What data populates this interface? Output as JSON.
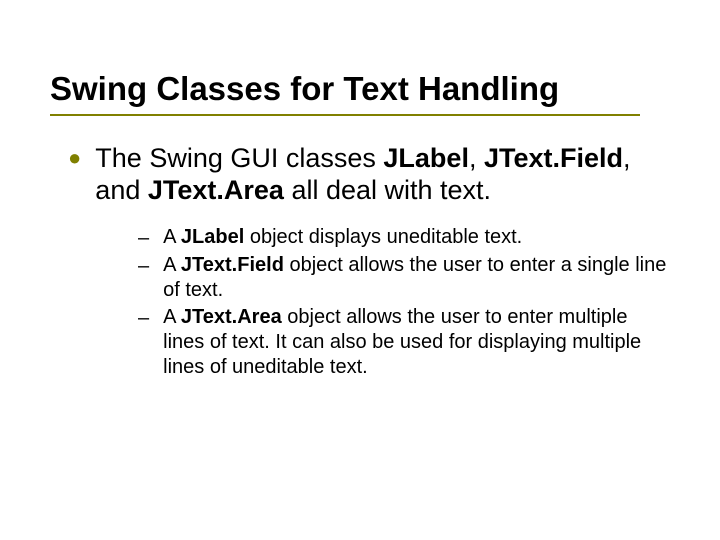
{
  "title": "Swing Classes for Text Handling",
  "intro": {
    "pre": "The Swing GUI classes ",
    "c1": "JLabel",
    "mid1": ", ",
    "c2": "JText.Field",
    "mid2": ", and ",
    "c3": "JText.Area",
    "post": " all deal with text."
  },
  "items": [
    {
      "pre": "A ",
      "b": "JLabel",
      "post": " object displays uneditable text."
    },
    {
      "pre": "A ",
      "b": "JText.Field",
      "post": " object allows the user to enter a single line of text."
    },
    {
      "pre": "A ",
      "b": "JText.Area",
      "post": " object allows the user to enter multiple lines of text. It can also be used for displaying multiple lines of uneditable text."
    }
  ]
}
